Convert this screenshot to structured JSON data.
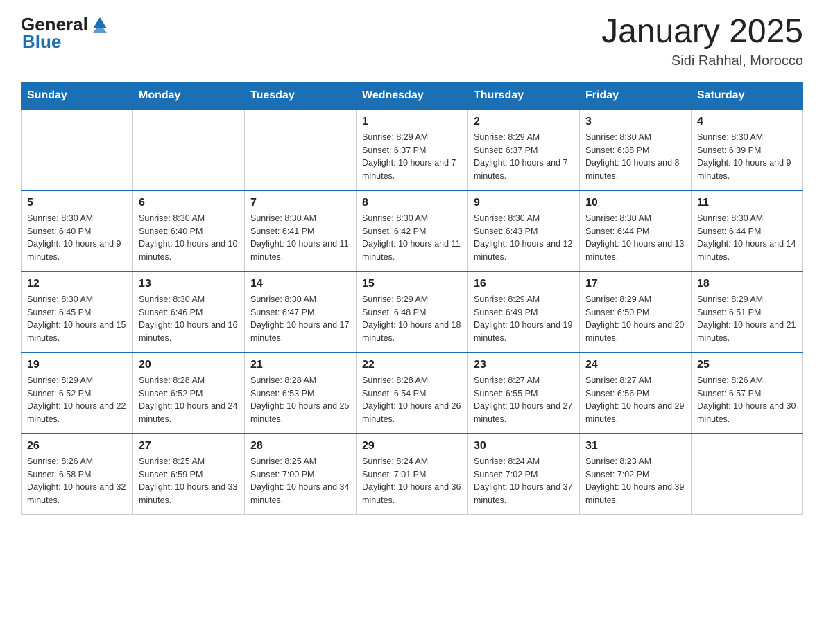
{
  "header": {
    "logo_general": "General",
    "logo_blue": "Blue",
    "title": "January 2025",
    "subtitle": "Sidi Rahhal, Morocco"
  },
  "days_of_week": [
    "Sunday",
    "Monday",
    "Tuesday",
    "Wednesday",
    "Thursday",
    "Friday",
    "Saturday"
  ],
  "weeks": [
    [
      {
        "day": "",
        "info": ""
      },
      {
        "day": "",
        "info": ""
      },
      {
        "day": "",
        "info": ""
      },
      {
        "day": "1",
        "info": "Sunrise: 8:29 AM\nSunset: 6:37 PM\nDaylight: 10 hours and 7 minutes."
      },
      {
        "day": "2",
        "info": "Sunrise: 8:29 AM\nSunset: 6:37 PM\nDaylight: 10 hours and 7 minutes."
      },
      {
        "day": "3",
        "info": "Sunrise: 8:30 AM\nSunset: 6:38 PM\nDaylight: 10 hours and 8 minutes."
      },
      {
        "day": "4",
        "info": "Sunrise: 8:30 AM\nSunset: 6:39 PM\nDaylight: 10 hours and 9 minutes."
      }
    ],
    [
      {
        "day": "5",
        "info": "Sunrise: 8:30 AM\nSunset: 6:40 PM\nDaylight: 10 hours and 9 minutes."
      },
      {
        "day": "6",
        "info": "Sunrise: 8:30 AM\nSunset: 6:40 PM\nDaylight: 10 hours and 10 minutes."
      },
      {
        "day": "7",
        "info": "Sunrise: 8:30 AM\nSunset: 6:41 PM\nDaylight: 10 hours and 11 minutes."
      },
      {
        "day": "8",
        "info": "Sunrise: 8:30 AM\nSunset: 6:42 PM\nDaylight: 10 hours and 11 minutes."
      },
      {
        "day": "9",
        "info": "Sunrise: 8:30 AM\nSunset: 6:43 PM\nDaylight: 10 hours and 12 minutes."
      },
      {
        "day": "10",
        "info": "Sunrise: 8:30 AM\nSunset: 6:44 PM\nDaylight: 10 hours and 13 minutes."
      },
      {
        "day": "11",
        "info": "Sunrise: 8:30 AM\nSunset: 6:44 PM\nDaylight: 10 hours and 14 minutes."
      }
    ],
    [
      {
        "day": "12",
        "info": "Sunrise: 8:30 AM\nSunset: 6:45 PM\nDaylight: 10 hours and 15 minutes."
      },
      {
        "day": "13",
        "info": "Sunrise: 8:30 AM\nSunset: 6:46 PM\nDaylight: 10 hours and 16 minutes."
      },
      {
        "day": "14",
        "info": "Sunrise: 8:30 AM\nSunset: 6:47 PM\nDaylight: 10 hours and 17 minutes."
      },
      {
        "day": "15",
        "info": "Sunrise: 8:29 AM\nSunset: 6:48 PM\nDaylight: 10 hours and 18 minutes."
      },
      {
        "day": "16",
        "info": "Sunrise: 8:29 AM\nSunset: 6:49 PM\nDaylight: 10 hours and 19 minutes."
      },
      {
        "day": "17",
        "info": "Sunrise: 8:29 AM\nSunset: 6:50 PM\nDaylight: 10 hours and 20 minutes."
      },
      {
        "day": "18",
        "info": "Sunrise: 8:29 AM\nSunset: 6:51 PM\nDaylight: 10 hours and 21 minutes."
      }
    ],
    [
      {
        "day": "19",
        "info": "Sunrise: 8:29 AM\nSunset: 6:52 PM\nDaylight: 10 hours and 22 minutes."
      },
      {
        "day": "20",
        "info": "Sunrise: 8:28 AM\nSunset: 6:52 PM\nDaylight: 10 hours and 24 minutes."
      },
      {
        "day": "21",
        "info": "Sunrise: 8:28 AM\nSunset: 6:53 PM\nDaylight: 10 hours and 25 minutes."
      },
      {
        "day": "22",
        "info": "Sunrise: 8:28 AM\nSunset: 6:54 PM\nDaylight: 10 hours and 26 minutes."
      },
      {
        "day": "23",
        "info": "Sunrise: 8:27 AM\nSunset: 6:55 PM\nDaylight: 10 hours and 27 minutes."
      },
      {
        "day": "24",
        "info": "Sunrise: 8:27 AM\nSunset: 6:56 PM\nDaylight: 10 hours and 29 minutes."
      },
      {
        "day": "25",
        "info": "Sunrise: 8:26 AM\nSunset: 6:57 PM\nDaylight: 10 hours and 30 minutes."
      }
    ],
    [
      {
        "day": "26",
        "info": "Sunrise: 8:26 AM\nSunset: 6:58 PM\nDaylight: 10 hours and 32 minutes."
      },
      {
        "day": "27",
        "info": "Sunrise: 8:25 AM\nSunset: 6:59 PM\nDaylight: 10 hours and 33 minutes."
      },
      {
        "day": "28",
        "info": "Sunrise: 8:25 AM\nSunset: 7:00 PM\nDaylight: 10 hours and 34 minutes."
      },
      {
        "day": "29",
        "info": "Sunrise: 8:24 AM\nSunset: 7:01 PM\nDaylight: 10 hours and 36 minutes."
      },
      {
        "day": "30",
        "info": "Sunrise: 8:24 AM\nSunset: 7:02 PM\nDaylight: 10 hours and 37 minutes."
      },
      {
        "day": "31",
        "info": "Sunrise: 8:23 AM\nSunset: 7:02 PM\nDaylight: 10 hours and 39 minutes."
      },
      {
        "day": "",
        "info": ""
      }
    ]
  ]
}
